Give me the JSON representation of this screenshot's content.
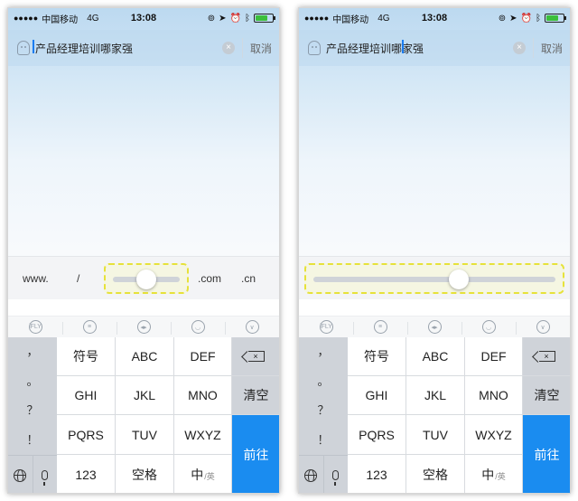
{
  "status": {
    "signal_dots": "●●●●●",
    "carrier": "中国移动",
    "network": "4G",
    "time": "13:08",
    "icons": [
      "rotation-lock-icon",
      "location-icon",
      "alarm-icon",
      "bluetooth-icon"
    ],
    "battery_level": 0.7
  },
  "search": {
    "text": "产品经理培训哪家强",
    "clear_glyph": "×",
    "cancel_label": "取消"
  },
  "url_keys": {
    "www": "www.",
    "slash": "/",
    "com": ".com",
    "cn": ".cn"
  },
  "slider_left": {
    "value": 0.5
  },
  "slider_right": {
    "value": 0.6
  },
  "toolbar": [
    "logo-icon",
    "chat-icon",
    "cursor-move-icon",
    "emoji-icon",
    "collapse-keyboard-icon"
  ],
  "keyboard": {
    "punctuation": [
      "，",
      "。",
      "？",
      "！"
    ],
    "rows": [
      [
        "符号",
        "ABC",
        "DEF"
      ],
      [
        "GHI",
        "JKL",
        "MNO"
      ],
      [
        "PQRS",
        "TUV",
        "WXYZ"
      ]
    ],
    "bottom": {
      "num": "123",
      "space": "空格",
      "zh": "中",
      "zh_small": "/英"
    },
    "clear": "清空",
    "go": "前往",
    "colors": {
      "go_button": "#1a8cf0",
      "function_key": "#cfd3d9"
    }
  }
}
